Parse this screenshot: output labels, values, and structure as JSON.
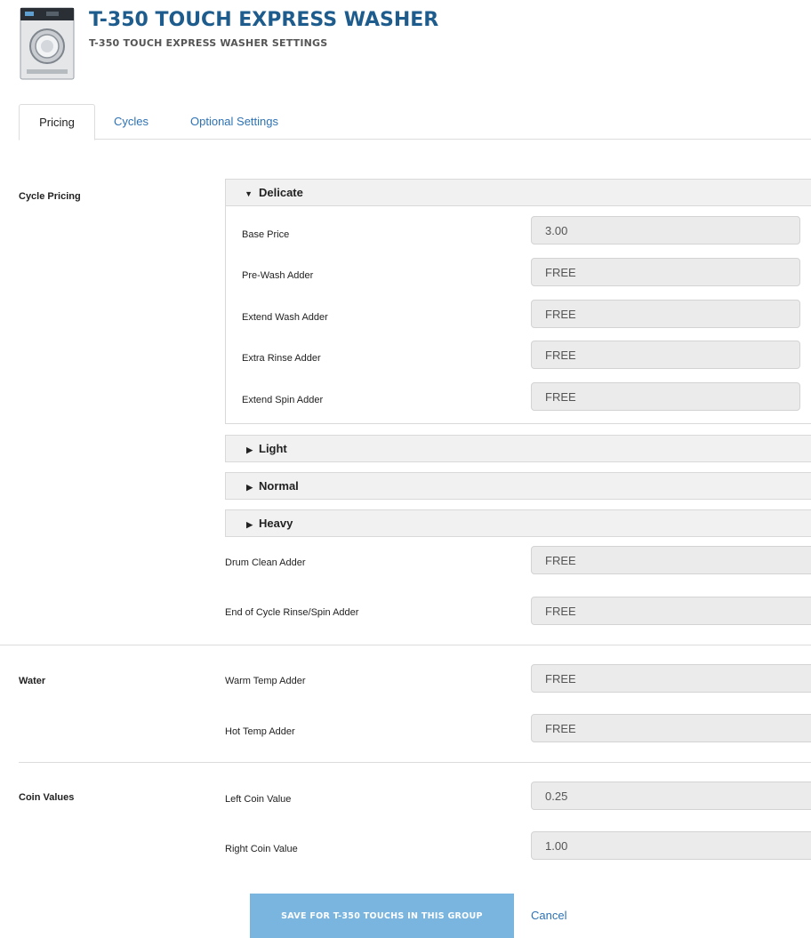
{
  "header": {
    "title": "T-350 TOUCH EXPRESS WASHER",
    "subtitle": "T-350 TOUCH EXPRESS WASHER SETTINGS"
  },
  "tabs": [
    {
      "label": "Pricing",
      "active": true
    },
    {
      "label": "Cycles",
      "active": false
    },
    {
      "label": "Optional Settings",
      "active": false
    }
  ],
  "cycle_pricing": {
    "section_label": "Cycle Pricing",
    "accordions": [
      {
        "label": "Delicate",
        "expanded": true
      },
      {
        "label": "Light",
        "expanded": false
      },
      {
        "label": "Normal",
        "expanded": false
      },
      {
        "label": "Heavy",
        "expanded": false
      }
    ],
    "delicate_fields": [
      {
        "label": "Base Price",
        "value": "3.00"
      },
      {
        "label": "Pre-Wash Adder",
        "value": "FREE"
      },
      {
        "label": "Extend Wash Adder",
        "value": "FREE"
      },
      {
        "label": "Extra Rinse Adder",
        "value": "FREE"
      },
      {
        "label": "Extend Spin Adder",
        "value": "FREE"
      }
    ],
    "extra_fields": [
      {
        "label": "Drum Clean Adder",
        "value": "FREE"
      },
      {
        "label": "End of Cycle Rinse/Spin Adder",
        "value": "FREE"
      }
    ]
  },
  "water": {
    "section_label": "Water",
    "fields": [
      {
        "label": "Warm Temp Adder",
        "value": "FREE"
      },
      {
        "label": "Hot Temp Adder",
        "value": "FREE"
      }
    ]
  },
  "coin_values": {
    "section_label": "Coin Values",
    "fields": [
      {
        "label": "Left Coin Value",
        "value": "0.25"
      },
      {
        "label": "Right Coin Value",
        "value": "1.00"
      }
    ]
  },
  "actions": {
    "save_label": "SAVE FOR T-350 TOUCHS IN THIS GROUP",
    "cancel_label": "Cancel"
  },
  "colors": {
    "title": "#1d5c8c",
    "link": "#2d72b5",
    "save_button": "#79b5df",
    "input_bg": "#ebebeb"
  },
  "icons": {
    "washer": "washer-machine-icon",
    "expanded": "caret-down-icon",
    "collapsed": "caret-right-icon"
  }
}
